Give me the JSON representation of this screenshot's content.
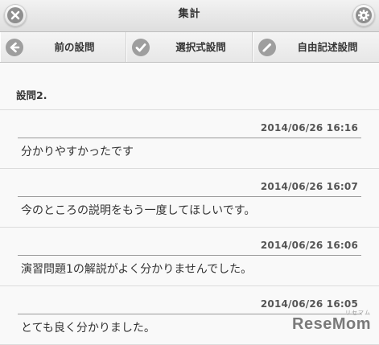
{
  "header": {
    "title": "集計",
    "close_icon": "close-icon",
    "settings_icon": "gear-icon"
  },
  "nav": {
    "prev_label": "前の設問",
    "prev_icon": "arrow-left-icon",
    "choice_label": "選択式設問",
    "choice_icon": "checkmark-icon",
    "free_label": "自由記述設問",
    "free_icon": "pencil-icon"
  },
  "question": {
    "heading": "設問2."
  },
  "responses": [
    {
      "timestamp": "2014/06/26 16:16",
      "text": "分かりやすかったです"
    },
    {
      "timestamp": "2014/06/26 16:07",
      "text": "今のところの説明をもう一度してほしいです。"
    },
    {
      "timestamp": "2014/06/26 16:06",
      "text": "演習問題1の解説がよく分かりませんでした。"
    },
    {
      "timestamp": "2014/06/26 16:05",
      "text": "とても良く分かりました。"
    }
  ],
  "watermark": {
    "text": "ReseMom",
    "small_text": "リセマム"
  },
  "colors": {
    "header_bg": "#e8e8e8",
    "icon_gray": "#8f8f8f",
    "text": "#333333",
    "rule": "#9a9a9a"
  }
}
